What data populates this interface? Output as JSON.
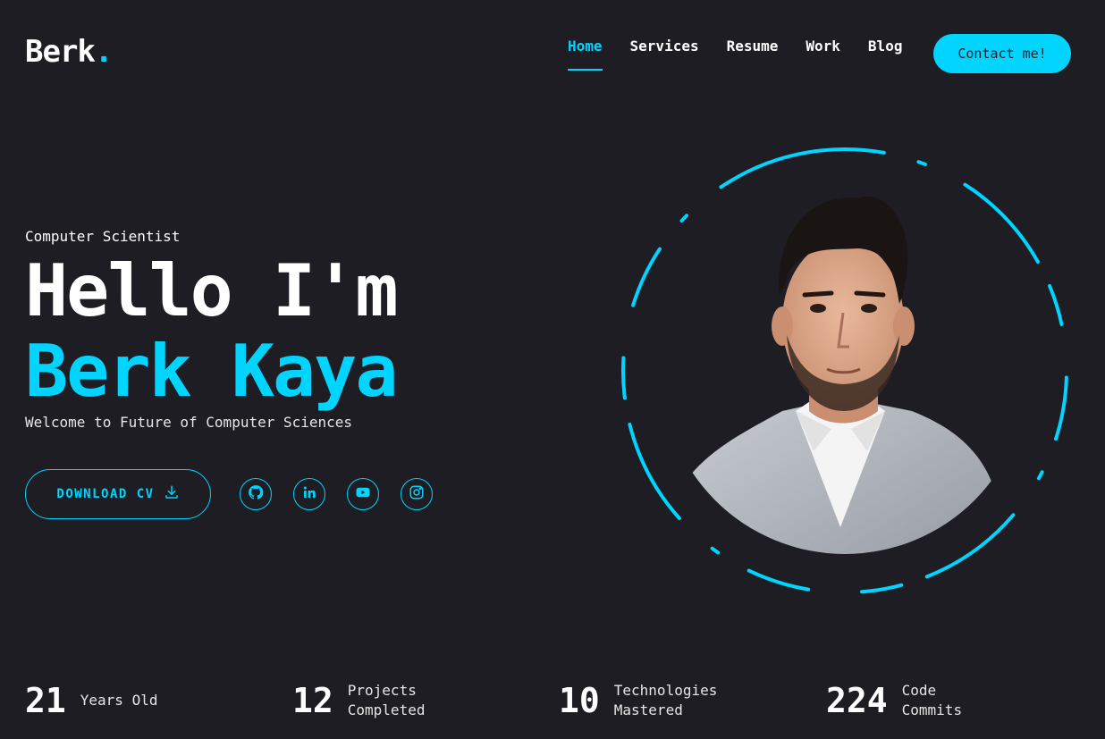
{
  "logo": {
    "name": "Berk",
    "dot": "."
  },
  "nav": {
    "items": [
      {
        "label": "Home",
        "active": true
      },
      {
        "label": "Services"
      },
      {
        "label": "Resume"
      },
      {
        "label": "Work"
      },
      {
        "label": "Blog"
      }
    ]
  },
  "header": {
    "contact_label": "Contact me!"
  },
  "hero": {
    "role": "Computer Scientist",
    "greeting": "Hello I'm",
    "name": "Berk Kaya",
    "tagline": "Welcome to Future of Computer Sciences",
    "cv_label": "DOWNLOAD CV"
  },
  "socials": [
    {
      "icon": "github-icon"
    },
    {
      "icon": "linkedin-icon"
    },
    {
      "icon": "youtube-icon"
    },
    {
      "icon": "instagram-icon"
    }
  ],
  "stats": [
    {
      "num": "21",
      "line1": "Years Old",
      "line2": ""
    },
    {
      "num": "12",
      "line1": "Projects",
      "line2": "Completed"
    },
    {
      "num": "10",
      "line1": "Technologies",
      "line2": "Mastered"
    },
    {
      "num": "224",
      "line1": "Code",
      "line2": "Commits"
    }
  ],
  "colors": {
    "accent": "#00d4ff",
    "background": "#1d1d23",
    "text": "#ffffff"
  }
}
